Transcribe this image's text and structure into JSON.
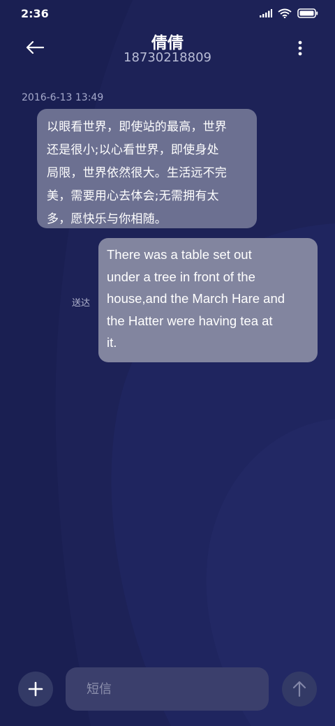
{
  "status_bar": {
    "time": "2:36",
    "icons": [
      "signal-icon",
      "wifi-icon",
      "battery-icon"
    ]
  },
  "header": {
    "back_icon": "arrow-left-icon",
    "contact_name": "倩倩",
    "phone_number": "18730218809",
    "more_icon": "more-vertical-icon"
  },
  "conversation": {
    "timestamp": "2016-6-13 13:49",
    "incoming_lines": [
      "以眼看世界，即使站的最高，世界",
      "还是很小;以心看世界，即使身处",
      "局限，世界依然很大。生活远不完",
      "美，需要用心去体会;无需拥有太",
      "多，愿快乐与你相随。"
    ],
    "outgoing_lines": [
      "There was a table set out",
      "under a tree in front of the",
      "house,and the March Hare and",
      "the Hatter were having tea at",
      "it."
    ],
    "delivered_label": "送达"
  },
  "composer": {
    "add_icon": "plus-icon",
    "placeholder": "短信",
    "send_icon": "arrow-up-icon"
  },
  "colors": {
    "background": "#1d2257",
    "incoming_bubble": "#6c7091",
    "outgoing_bubble": "#82859f",
    "composer_field": "#3b3f6c",
    "round_button": "#333a66"
  }
}
